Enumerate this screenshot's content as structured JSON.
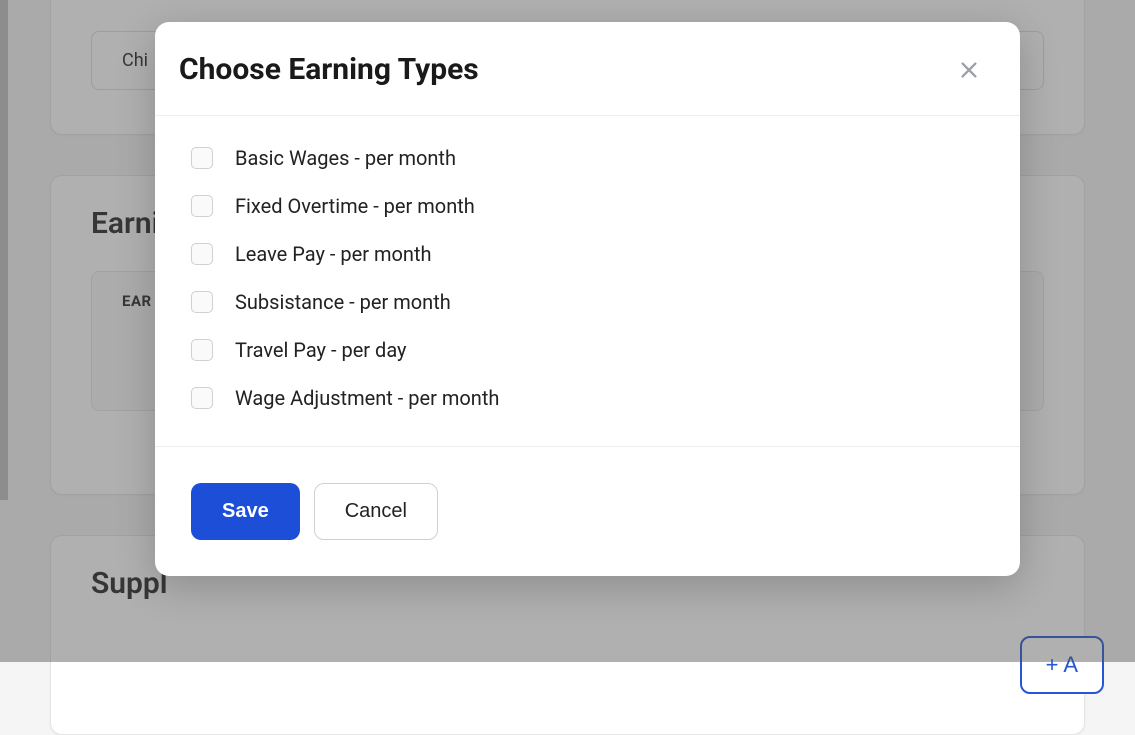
{
  "background": {
    "chip_text": "Chi",
    "section_earnings": "Earnin",
    "table_header": "EAR",
    "section_supplements": "Suppl",
    "add_btn": "+  A"
  },
  "modal": {
    "title": "Choose Earning Types",
    "options": [
      {
        "label": "Basic Wages - per month"
      },
      {
        "label": "Fixed Overtime - per month"
      },
      {
        "label": "Leave Pay - per month"
      },
      {
        "label": "Subsistance - per month"
      },
      {
        "label": "Travel Pay - per day"
      },
      {
        "label": "Wage Adjustment - per month"
      }
    ],
    "save_label": "Save",
    "cancel_label": "Cancel"
  }
}
